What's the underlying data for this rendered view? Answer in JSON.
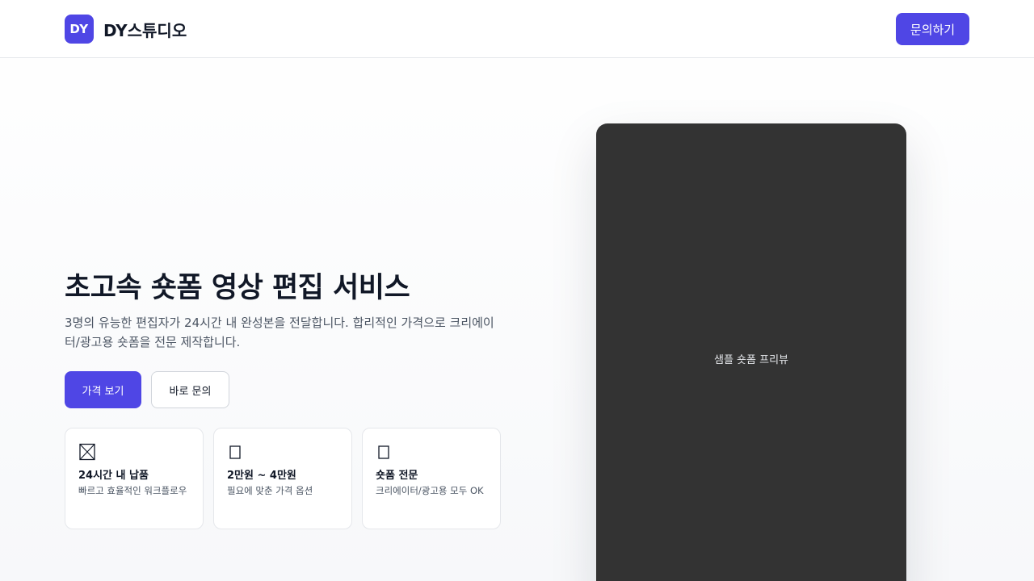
{
  "header": {
    "logo_text": "DY",
    "brand_name": "DY스튜디오",
    "contact_label": "문의하기"
  },
  "hero": {
    "title": "초고속 숏폼 영상 편집 서비스",
    "subtitle": "3명의 유능한 편집자가 24시간 내 완성본을 전달합니다. 합리적인 가격으로 크리에이터/광고용 숏폼을 전문 제작합니다.",
    "primary_button": "가격 보기",
    "secondary_button": "바로 문의"
  },
  "features": [
    {
      "icon": "hourglass-icon",
      "title": "24시간 내 납품",
      "desc": "빠르고 효율적인 워크플로우"
    },
    {
      "icon": "money-icon",
      "title": "2만원 ~ 4만원",
      "desc": "필요에 맞춘 가격 옵션"
    },
    {
      "icon": "video-icon",
      "title": "숏폼 전문",
      "desc": "크리에이터/광고용 모두 OK"
    }
  ],
  "preview": {
    "label": "샘플 숏폼 프리뷰"
  },
  "colors": {
    "accent": "#4f46e5",
    "preview_bg": "#333333",
    "text_primary": "#111827",
    "text_secondary": "#4b5563"
  }
}
